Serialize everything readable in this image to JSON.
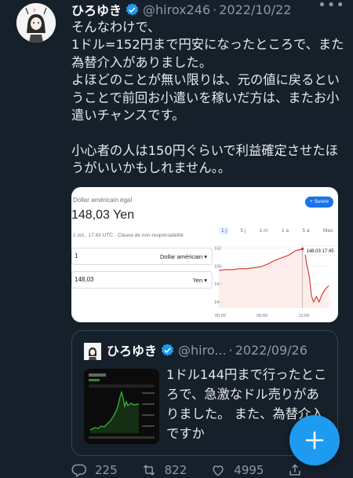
{
  "tweet": {
    "name": "ひろゆき",
    "handle": "@hirox246",
    "separator": "·",
    "date": "2022/10/22",
    "more": "•••",
    "text": "そんなわけで、\n1ドル=152円まで円安になったところで、また為替介入がありました。\nよほどのことが無い限りは、元の値に戻るということで前回お小遣いを稼いだ方は、またお小遣いチャンスです。\n\n小心者の人は150円ぐらいで利益確定させたほうがいいかもしれません。。"
  },
  "card": {
    "subtitle": "Dollar américain égal",
    "value": "148,03 Yen",
    "meta": "1 oct., 17:43 UTC · Clause de non-responsabilité",
    "follow_label": "+ Suivre",
    "ranges": [
      "1 j",
      "5 j",
      "1 m",
      "1 a",
      "5 a",
      "Max."
    ],
    "active_range": "1 j",
    "from_amount": "1",
    "from_currency": "Dollar américain ▾",
    "to_amount": "148,03",
    "to_currency": "Yen ▾",
    "tooltip": "148,03  17:45"
  },
  "chart_data": {
    "type": "line",
    "title": "",
    "xlabel": "",
    "ylabel": "",
    "x_ticks": [
      "00:00",
      "06:00",
      "12:00"
    ],
    "y_ticks": [
      152,
      150,
      148,
      146
    ],
    "ylim": [
      145.3,
      152.3
    ],
    "x": [
      0,
      1,
      2,
      3,
      4,
      5,
      6,
      7,
      8,
      9,
      10,
      11,
      12,
      12.3,
      12.6,
      13,
      13.3,
      13.6,
      14,
      14.4,
      14.8,
      15.2,
      15.5,
      15.8
    ],
    "series": [
      {
        "values": [
          149.5,
          149.6,
          149.6,
          149.7,
          149.7,
          149.8,
          149.9,
          150.2,
          150.6,
          150.9,
          151.2,
          151.7,
          151.9,
          151.9,
          150.3,
          148.8,
          146.7,
          146.0,
          146.6,
          146.0,
          146.8,
          147.3,
          147.6,
          147.8
        ]
      }
    ],
    "grid": true,
    "line_color": "#d93025"
  },
  "quote": {
    "name": "ひろゆき",
    "handle": "@hiro...",
    "separator": "·",
    "date": "2022/09/26",
    "text": "1ドル144円まで行ったところで、急激なドル売りがありました。\nまた、為替介入ですか"
  },
  "actions": {
    "replies": "225",
    "retweets": "822",
    "likes": "4995"
  },
  "colors": {
    "background": "#15202b",
    "verified": "#1d9bf0",
    "fab": "#1d9bf0"
  }
}
